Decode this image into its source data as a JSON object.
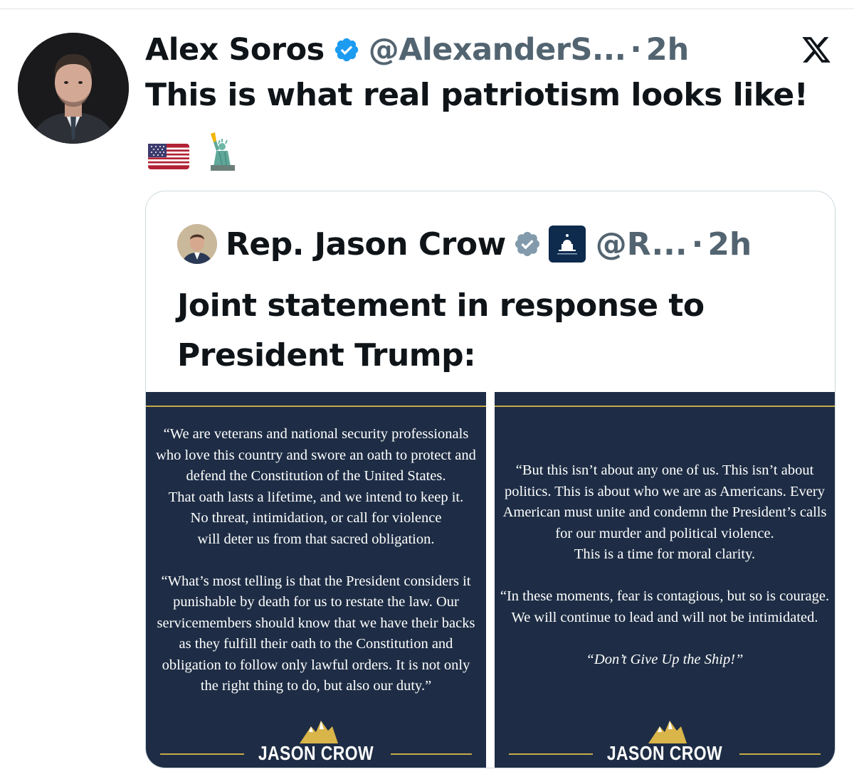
{
  "tweet": {
    "author_name": "Alex Soros",
    "handle": "@AlexanderS...",
    "separator": "·",
    "time": "2h",
    "text": "This is what real patriotism looks like!"
  },
  "quoted": {
    "author_name": "Rep. Jason Crow",
    "handle": "@R...",
    "separator": "·",
    "time": "2h",
    "text": "Joint statement in response to President Trump:",
    "images": {
      "left": {
        "paragraphs": [
          [
            "“We are veterans and national security professionals",
            "who love this country and swore an oath to protect and",
            "defend the Constitution of the United States.",
            "That oath lasts a lifetime, and we intend to keep it.",
            "No threat, intimidation, or call for violence",
            "will deter us from that sacred obligation."
          ],
          [
            "“What’s most telling is that the President considers it",
            "punishable by death for us to restate the law. Our",
            "servicemembers should know that we have their backs",
            "as they fulfill their oath to the Constitution and",
            "obligation to follow only lawful orders. It is not only",
            "the right thing to do, but also our duty.”"
          ]
        ],
        "footer": "JASON CROW"
      },
      "right": {
        "paragraphs": [
          [
            "“But this isn’t about any one of us. This isn’t about",
            "politics. This is about who we are as Americans. Every",
            "American must unite and condemn the President’s calls",
            "for our murder and political violence.",
            "This is a time for moral clarity."
          ],
          [
            "“In these moments, fear is contagious, but so is courage.",
            "We will continue to lead and will not be intimidated."
          ]
        ],
        "motto": "“Don’t Give Up the Ship!”",
        "footer": "JASON CROW"
      }
    }
  },
  "colors": {
    "text": "#0f1419",
    "secondary": "#536471",
    "verified": "#1d9bf0",
    "panel_bg": "#1e2d45",
    "gold": "#c9a94b"
  },
  "icons": {
    "verified": "verified-badge-icon",
    "x_logo": "x-logo-icon",
    "flag": "us-flag-emoji",
    "liberty": "statue-of-liberty-emoji",
    "capitol": "house-democrats-capitol-icon",
    "mountains": "jason-crow-mountain-logo"
  }
}
